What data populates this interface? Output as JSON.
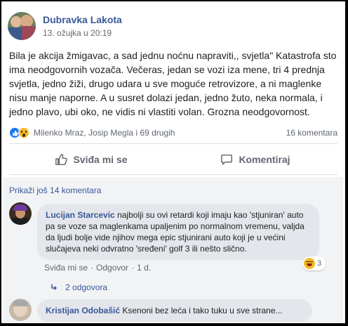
{
  "post": {
    "author": "Dubravka Lakota",
    "date": "13. ožujka u 20:19",
    "menu": "•••",
    "body": "Bila je akcija žmigavac, a sad jednu noćnu napraviti,, svjetla\" Katastrofa sto ima neodgovornih vozača. Večeras, jedan se vozi iza mene, tri 4 prednja svjetla, jedno žiži, drugo udara u sve moguće retrovizore, a ni maglenke nisu manje naporne. A u susret dolazi jedan, jedno žuto, neka normala, i jedno plavo, ubi oko, ne vidis ni vlastiti volan. Grozna neodgovornost."
  },
  "reactions": {
    "names": "Milenko Mraz, Josip Megla i 69 drugih",
    "comment_count": "16 komentara"
  },
  "actions": {
    "like_label": "Sviđa mi se",
    "comment_label": "Komentiraj"
  },
  "comments": {
    "more_label": "Prikaži još 14 komentara",
    "items": [
      {
        "name": "Lucijan Starcevic",
        "text": "najbolji su ovi retardi koji imaju kao 'stjuniran' auto pa se voze sa maglenkama upaljenim po normalnom vremenu, valjda da ljudi bolje vide njihov mega epic stjunirani auto koji je u većini slučajeva neki odvratno 'sređeni' golf 3 ili nešto slično.",
        "reaction_count": "3",
        "like_label": "Sviđa mi se",
        "separator": "·",
        "reply_label": "Odgovor",
        "age": "1 d.",
        "replies_label": "2 odgovora"
      },
      {
        "name": "Kristijan Odobašić",
        "text": "Ksenoni bez leća i tako tuku u sve strane..."
      }
    ]
  },
  "icons": {
    "like": "thumbs-up-icon",
    "comment": "speech-bubble-icon",
    "wow": "wow-reaction-icon",
    "haha": "haha-reaction-icon",
    "privacy": "globe-icon",
    "reply_arrow": "reply-arrow-icon"
  },
  "colors": {
    "link": "#385898",
    "secondary_text": "#606770",
    "like_blue": "#1877f2",
    "reaction_yellow": "#f7b928",
    "comment_bg": "#f2f3f5",
    "bubble_bg": "#e4e6eb"
  }
}
